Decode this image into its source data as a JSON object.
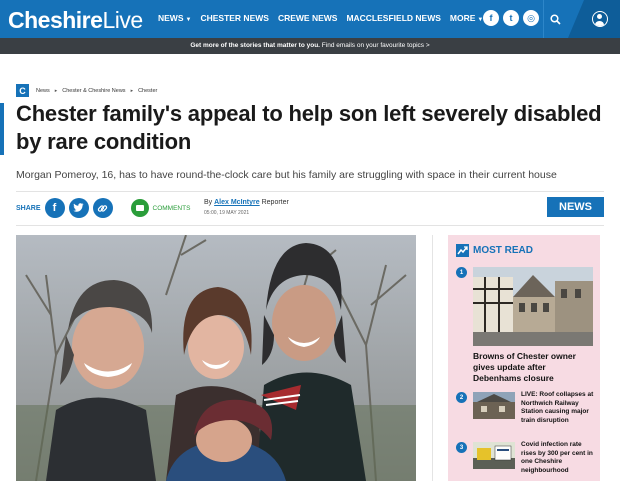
{
  "brand": {
    "name_bold": "Cheshire",
    "name_light": "Live"
  },
  "nav": {
    "items": [
      {
        "label": "NEWS",
        "has_caret": true
      },
      {
        "label": "CHESTER NEWS",
        "has_caret": false
      },
      {
        "label": "CREWE NEWS",
        "has_caret": false
      },
      {
        "label": "MACCLESFIELD NEWS",
        "has_caret": false
      },
      {
        "label": "MORE",
        "has_caret": true
      }
    ],
    "social": [
      "f",
      "t",
      "◎"
    ],
    "icons": [
      "facebook-icon",
      "twitter-icon",
      "instagram-icon",
      "search-icon",
      "account-icon"
    ]
  },
  "promo": {
    "bold": "Get more of the stories that matter to you.",
    "rest": " Find emails on your favourite topics >"
  },
  "breadcrumb": {
    "logo_letter": "C",
    "items": [
      "News",
      "Chester & Cheshire News",
      "Chester"
    ]
  },
  "article": {
    "headline": "Chester family's appeal to help son left severely disabled by rare condition",
    "standfirst": "Morgan Pomeroy, 16, has to have round-the-clock care but his family are struggling with space in their current house",
    "share_label": "SHARE",
    "comments_label": "COMMENTS",
    "byline_prefix": "By ",
    "author": "Alex McIntyre",
    "author_role": " Reporter",
    "date": "05:00, 19 MAY 2021",
    "section_tag": "NEWS"
  },
  "most_read": {
    "title": "MOST READ",
    "items": [
      {
        "rank": "1",
        "headline": "Browns of Chester owner gives update after Debenhams closure"
      },
      {
        "rank": "2",
        "headline": "LIVE: Roof collapses at Northwich Railway Station causing major train disruption"
      },
      {
        "rank": "3",
        "headline": "Covid infection rate rises by 300 per cent in one Cheshire neighbourhood"
      }
    ]
  },
  "colors": {
    "brand_blue": "#1672b8",
    "promo_bar": "#3a3f44",
    "sidebar_bg": "#f7dbe3",
    "comment_green": "#2a9d3a"
  }
}
